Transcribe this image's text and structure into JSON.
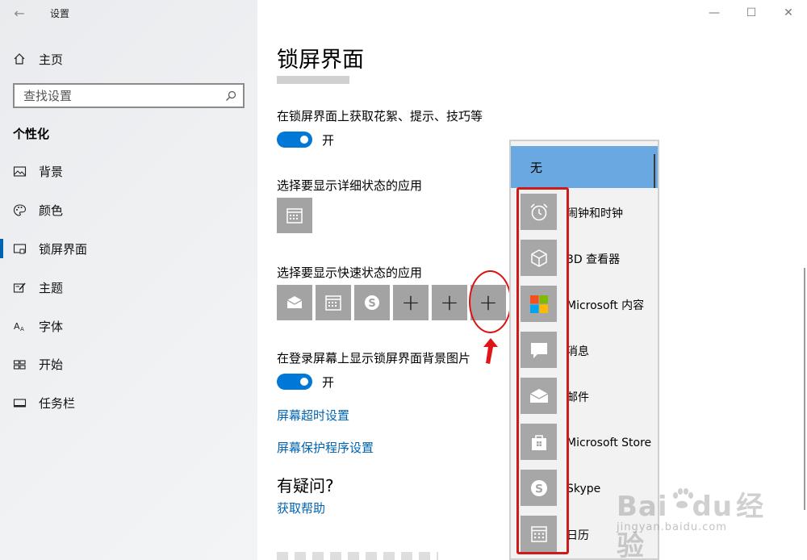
{
  "window": {
    "title": "设置",
    "back_glyph": "←",
    "minimize_glyph": "—",
    "maximize_glyph": "☐",
    "close_glyph": "✕"
  },
  "nav": {
    "home_label": "主页",
    "search_placeholder": "查找设置",
    "section_title": "个性化",
    "items": [
      {
        "label": "背景",
        "icon": "image-icon"
      },
      {
        "label": "颜色",
        "icon": "palette-icon"
      },
      {
        "label": "锁屏界面",
        "icon": "lock-screen-icon",
        "active": true
      },
      {
        "label": "主题",
        "icon": "theme-icon"
      },
      {
        "label": "字体",
        "icon": "font-icon"
      },
      {
        "label": "开始",
        "icon": "start-icon"
      },
      {
        "label": "任务栏",
        "icon": "taskbar-icon"
      }
    ]
  },
  "content": {
    "page_title": "锁屏界面",
    "tips_label": "在锁屏界面上获取花絮、提示、技巧等",
    "tips_toggle_state": "开",
    "detailed_label": "选择要显示详细状态的应用",
    "quick_label": "选择要显示快速状态的应用",
    "signin_bg_label": "在登录屏幕上显示锁屏界面背景图片",
    "signin_toggle_state": "开",
    "screen_timeout_link": "屏幕超时设置",
    "screensaver_link": "屏幕保护程序设置",
    "question_title": "有疑问?",
    "help_link": "获取帮助",
    "plus_glyph": "+"
  },
  "flyout": {
    "selected": "无",
    "items": [
      {
        "label": "闹钟和时钟",
        "icon": "alarm-clock-icon"
      },
      {
        "label": "3D 查看器",
        "icon": "cube-3d-icon"
      },
      {
        "label": "Microsoft 内容",
        "icon": "microsoft-logo-icon"
      },
      {
        "label": "消息",
        "icon": "message-icon"
      },
      {
        "label": "邮件",
        "icon": "mail-icon"
      },
      {
        "label": "Microsoft Store",
        "icon": "store-bag-icon"
      },
      {
        "label": "Skype",
        "icon": "skype-icon"
      },
      {
        "label": "日历",
        "icon": "calendar-icon"
      }
    ]
  },
  "watermark": {
    "brand_a": "Bai",
    "brand_b": "du",
    "brand_cn": "经验",
    "url": "jingyan.baidu.com"
  },
  "colors": {
    "accent": "#0078d7",
    "link": "#0063b1",
    "flyout_selected": "#6aa8e2",
    "annotation_red": "#cf1a1a"
  }
}
